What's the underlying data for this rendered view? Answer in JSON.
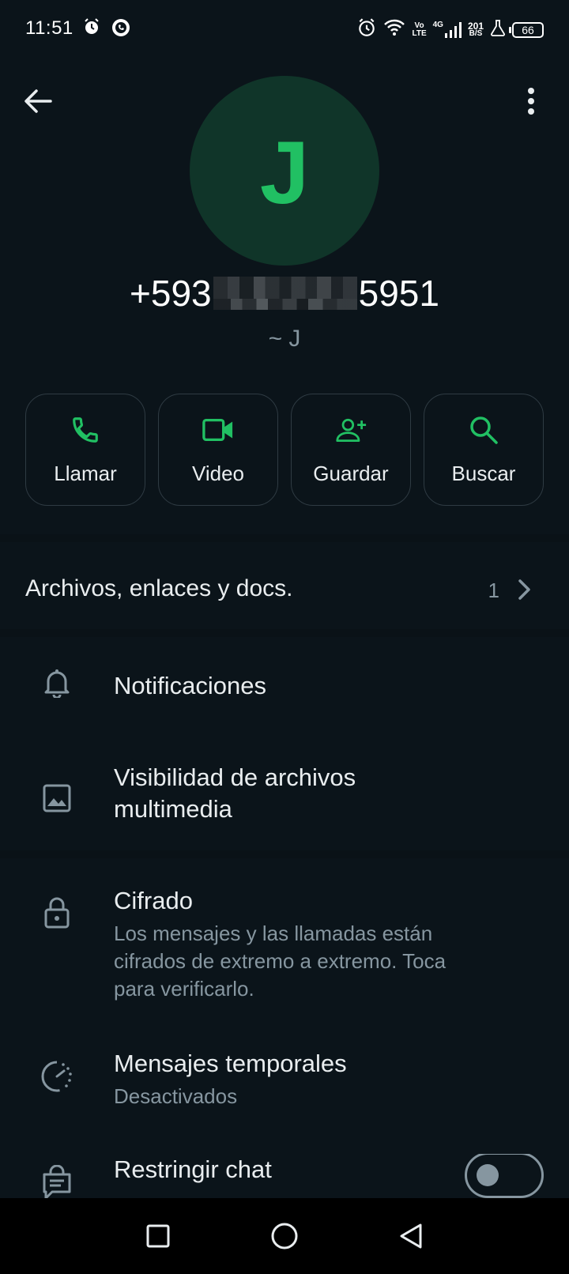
{
  "status_bar": {
    "time": "11:51",
    "network_label_top": "Vo",
    "network_label_bottom": "LTE",
    "network_type": "4G",
    "speed_value": "201",
    "speed_unit": "B/S",
    "battery": "66"
  },
  "contact": {
    "avatar_letter": "J",
    "phone_prefix": "+593",
    "phone_suffix": "5951",
    "push_name": "~ J"
  },
  "actions": [
    {
      "label": "Llamar",
      "icon": "phone-icon"
    },
    {
      "label": "Video",
      "icon": "video-icon"
    },
    {
      "label": "Guardar",
      "icon": "add-contact-icon"
    },
    {
      "label": "Buscar",
      "icon": "search-icon"
    }
  ],
  "media": {
    "label": "Archivos, enlaces y docs.",
    "count": "1"
  },
  "settings": {
    "notifications": {
      "title": "Notificaciones"
    },
    "media_visibility": {
      "title_line1": "Visibilidad de archivos",
      "title_line2": "multimedia"
    },
    "encryption": {
      "title": "Cifrado",
      "sub_line1": "Los mensajes y las llamadas están",
      "sub_line2": "cifrados de extremo a extremo. Toca",
      "sub_line3": "para verificarlo."
    },
    "disappearing": {
      "title": "Mensajes temporales",
      "sub": "Desactivados"
    },
    "restrict": {
      "title": "Restringir chat",
      "toggle_on": false
    }
  },
  "colors": {
    "accent": "#21c063",
    "background": "#0b141a",
    "secondary_text": "#8696a0"
  }
}
